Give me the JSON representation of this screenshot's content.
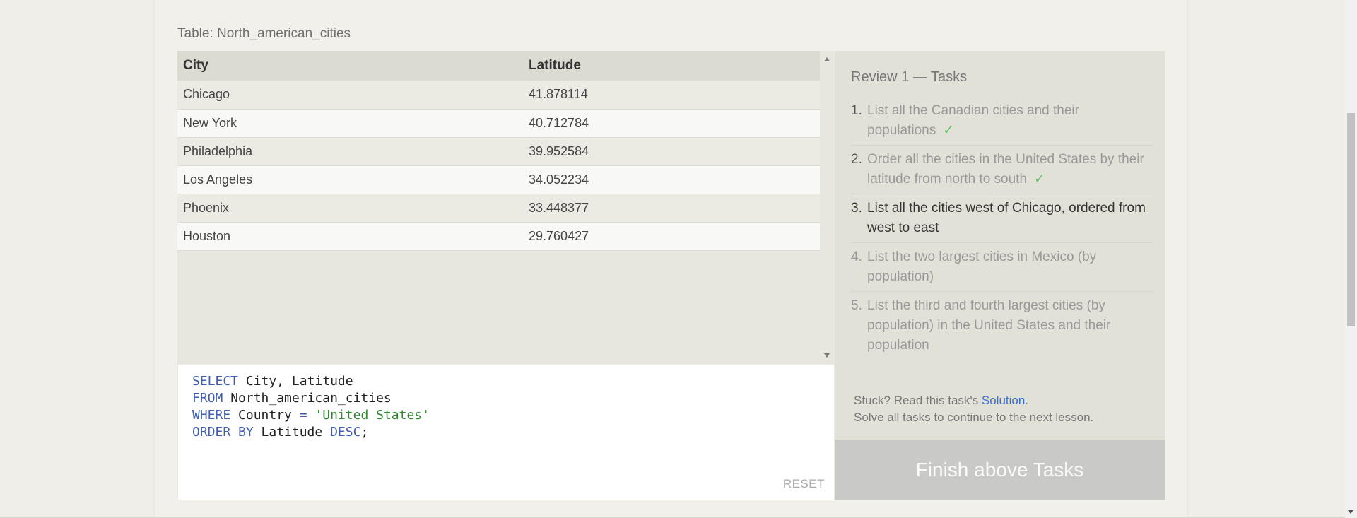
{
  "table_caption": "Table: North_american_cities",
  "results": {
    "columns": [
      "City",
      "Latitude"
    ],
    "rows": [
      [
        "Chicago",
        "41.878114"
      ],
      [
        "New York",
        "40.712784"
      ],
      [
        "Philadelphia",
        "39.952584"
      ],
      [
        "Los Angeles",
        "34.052234"
      ],
      [
        "Phoenix",
        "33.448377"
      ],
      [
        "Houston",
        "29.760427"
      ]
    ]
  },
  "editor": {
    "lines": [
      [
        {
          "k": "SELECT"
        },
        {
          "t": " City, Latitude"
        }
      ],
      [
        {
          "k": "FROM"
        },
        {
          "t": " North_american_cities"
        }
      ],
      [
        {
          "k": "WHERE"
        },
        {
          "t": " Country "
        },
        {
          "k": "="
        },
        {
          "t": " "
        },
        {
          "s": "'United States'"
        }
      ],
      [
        {
          "k": "ORDER BY"
        },
        {
          "t": " Latitude "
        },
        {
          "k": "DESC"
        },
        {
          "t": ";"
        }
      ]
    ],
    "reset_label": "RESET"
  },
  "tasks": {
    "title": "Review 1 — Tasks",
    "items": [
      {
        "num": "1.",
        "text": "List all the Canadian cities and their populations",
        "state": "done"
      },
      {
        "num": "2.",
        "text": "Order all the cities in the United States by their latitude from north to south",
        "state": "done"
      },
      {
        "num": "3.",
        "text": "List all the cities west of Chicago, ordered from west to east",
        "state": "active"
      },
      {
        "num": "4.",
        "text": "List the two largest cities in Mexico (by population)",
        "state": "pending"
      },
      {
        "num": "5.",
        "text": "List the third and fourth largest cities (by population) in the United States and their population",
        "state": "pending"
      }
    ],
    "check_mark": "✓",
    "hint_prefix": "Stuck? Read this task's ",
    "hint_link": "Solution",
    "hint_suffix": ".",
    "hint_line2": "Solve all tasks to continue to the next lesson.",
    "finish_label": "Finish above Tasks"
  },
  "colors": {
    "keyword": "#3e5db3",
    "string": "#2f8a2f",
    "link": "#3a6fd8",
    "check": "#6bbf6b",
    "finish_button": "#c9c9c7"
  }
}
